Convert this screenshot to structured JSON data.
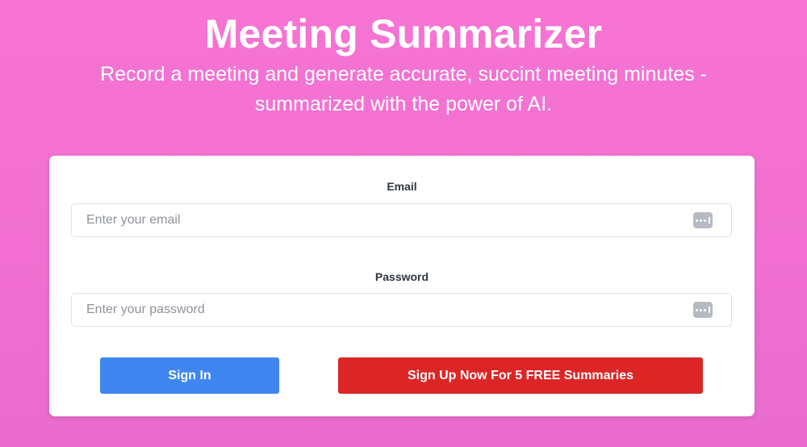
{
  "header": {
    "title": "Meeting Summarizer",
    "subtitle": "Record a meeting and generate accurate, succint meeting minutes - summarized with the power of AI."
  },
  "form": {
    "email": {
      "label": "Email",
      "value": "",
      "placeholder": "Enter your email",
      "icon": "password-manager-icon"
    },
    "password": {
      "label": "Password",
      "value": "",
      "placeholder": "Enter your password",
      "icon": "password-manager-icon"
    },
    "signin_label": "Sign In",
    "signup_label": "Sign Up Now For 5 FREE Summaries"
  },
  "colors": {
    "background": "#f374d2",
    "signin_button": "#3f86f0",
    "signup_button": "#dc2626",
    "card": "#ffffff"
  }
}
